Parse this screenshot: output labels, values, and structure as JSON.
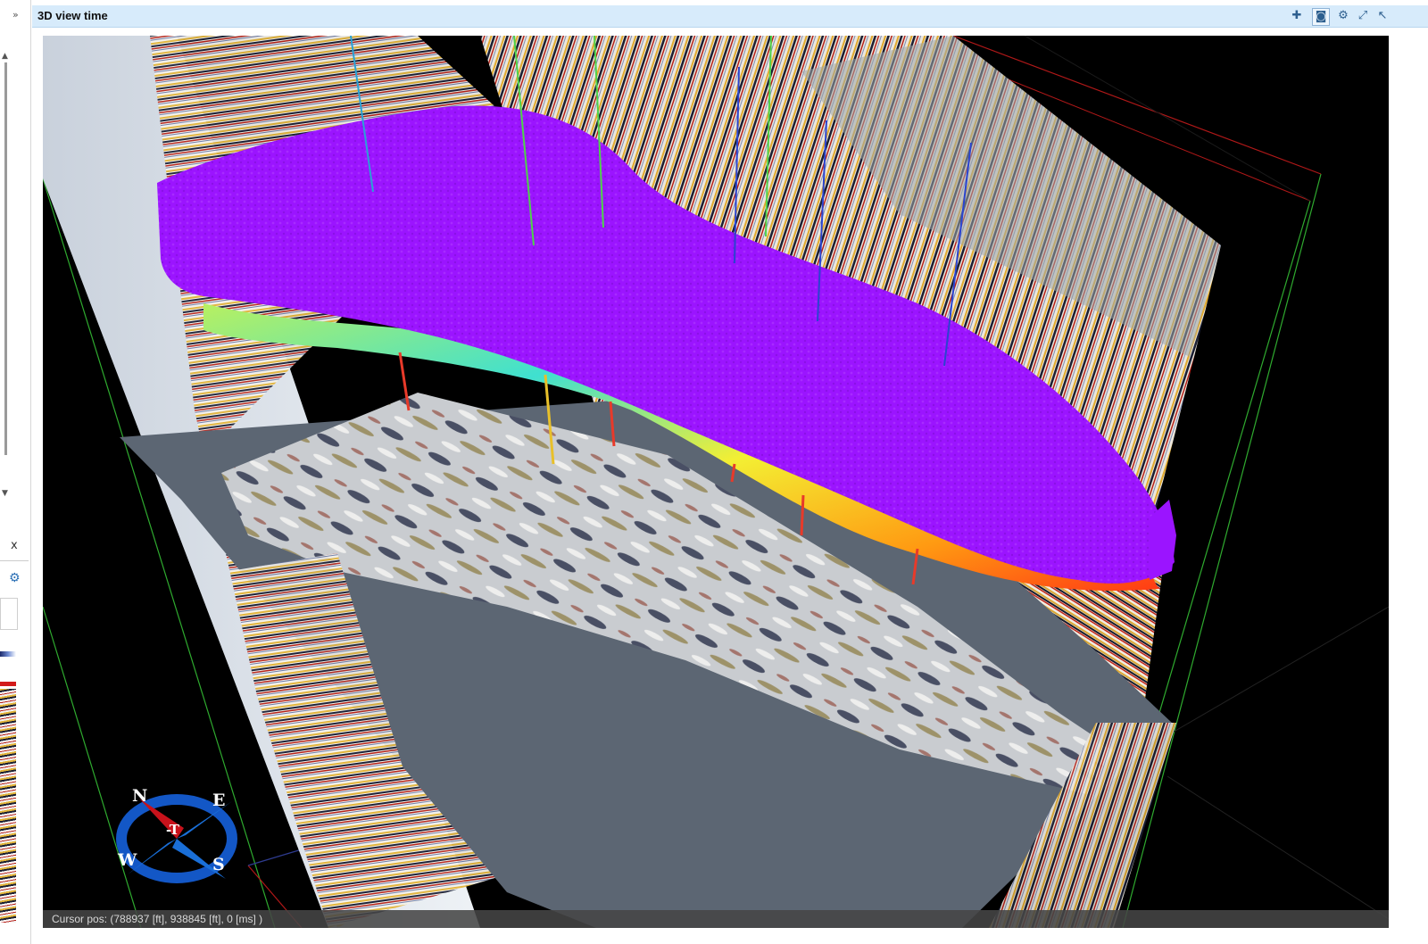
{
  "window": {
    "title": "3D view time"
  },
  "left_panel": {
    "expand_glyph": "»",
    "close_glyph": "x"
  },
  "toolbar": {
    "icons": [
      "pin-icon",
      "camera-icon",
      "gear-icon",
      "maximize-icon",
      "pointer-icon"
    ]
  },
  "compass": {
    "n": "N",
    "e": "E",
    "s": "S",
    "w": "W",
    "center": "-T"
  },
  "status": {
    "cursor_pos": "Cursor pos: (788937 [ft], 938845 [ft], 0 [ms] )"
  },
  "colors": {
    "background": "#000000",
    "horizon": "#9b14ff",
    "titlebar": "#d7ebfb",
    "grid_green": "#2faa2f",
    "grid_red": "#b01818"
  }
}
